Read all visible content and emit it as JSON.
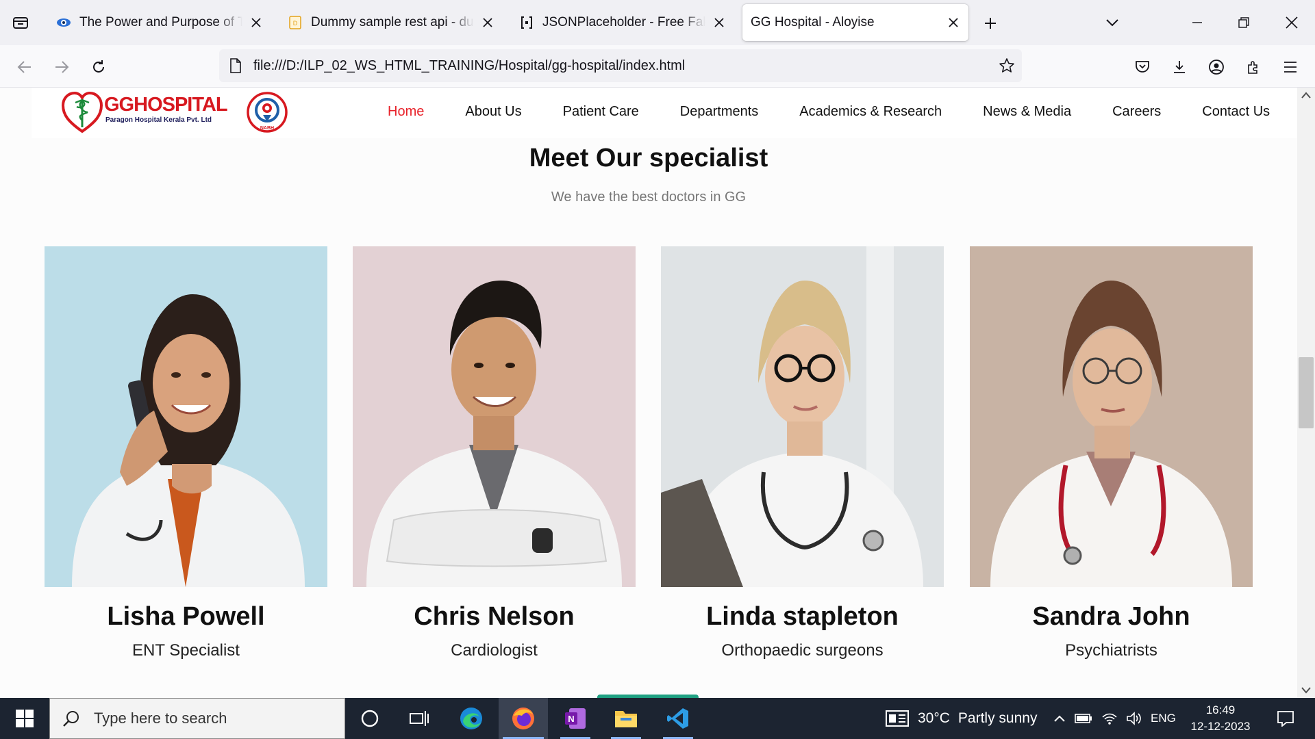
{
  "browser": {
    "tabs": [
      {
        "title": "The Power and Purpose of Teamwork",
        "favicon": "eye-logo-icon",
        "active": false
      },
      {
        "title": "Dummy sample rest api - dummy.restapiexample.com",
        "favicon": "api-page-icon",
        "active": false
      },
      {
        "title": "JSONPlaceholder - Free Fake REST API",
        "favicon": "json-icon",
        "active": false
      },
      {
        "title": "GG Hospital - Aloyise",
        "favicon": "none",
        "active": true
      }
    ],
    "url": "file:///D:/ILP_02_WS_HTML_TRAINING/Hospital/gg-hospital/index.html"
  },
  "site": {
    "logo": {
      "brand_gg": "GG",
      "brand_hospital": "HOSPITAL",
      "tagline": "Paragon Hospital Kerala Pvt. Ltd",
      "badge": "NABH"
    },
    "nav": [
      {
        "label": "Home",
        "current": true
      },
      {
        "label": "About Us",
        "current": false
      },
      {
        "label": "Patient Care",
        "current": false
      },
      {
        "label": "Departments",
        "current": false
      },
      {
        "label": "Academics & Research",
        "current": false
      },
      {
        "label": "News & Media",
        "current": false
      },
      {
        "label": "Careers",
        "current": false
      },
      {
        "label": "Contact Us",
        "current": false
      }
    ],
    "section": {
      "title": "Meet Our specialist",
      "subtitle": "We have the best doctors in GG"
    },
    "doctors": [
      {
        "name": "Lisha Powell",
        "role": "ENT Specialist",
        "photo": "doctor-photo-woman-phone"
      },
      {
        "name": "Chris Nelson",
        "role": "Cardiologist",
        "photo": "doctor-photo-man-arms-crossed"
      },
      {
        "name": "Linda stapleton",
        "role": "Orthopaedic surgeons",
        "photo": "doctor-photo-woman-glasses-clipboard"
      },
      {
        "name": "Sandra John",
        "role": "Psychiatrists",
        "photo": "doctor-photo-woman-glasses-stethoscope"
      }
    ],
    "colors": {
      "accent_red": "#e8222a",
      "brand_red": "#d71920",
      "nabh_blue": "#1f5fa8"
    }
  },
  "taskbar": {
    "search_placeholder": "Type here to search",
    "weather": {
      "temp": "30°C",
      "condition": "Partly sunny"
    },
    "language": "ENG",
    "time": "16:49",
    "date": "12-12-2023"
  }
}
